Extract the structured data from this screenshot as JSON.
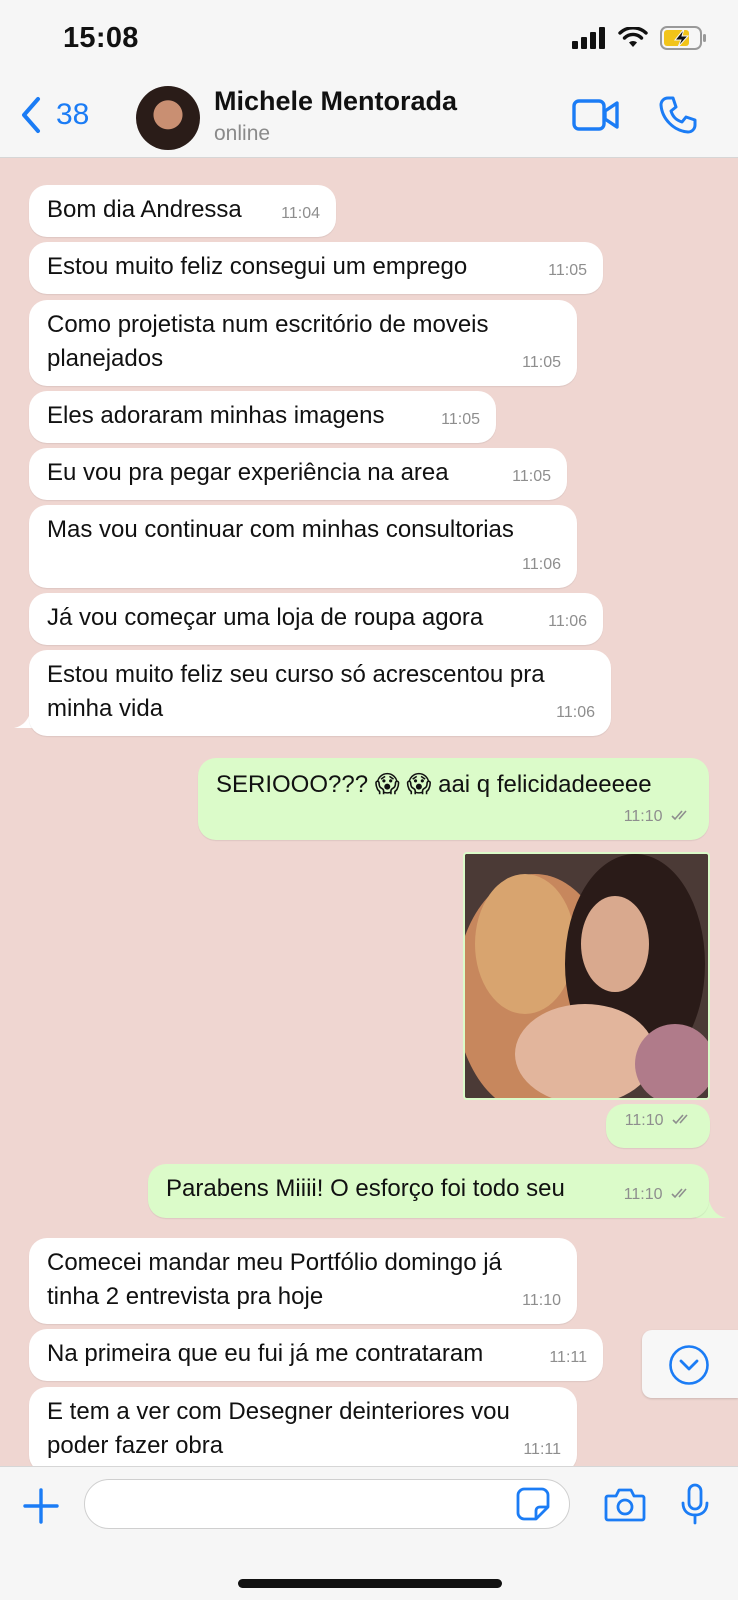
{
  "status_bar": {
    "time": "15:08"
  },
  "header": {
    "back_count": "38",
    "contact_name": "Michele Mentorada",
    "contact_status": "online"
  },
  "messages": [
    {
      "dir": "in",
      "text": "Bom dia Andressa",
      "time": "11:04"
    },
    {
      "dir": "in",
      "text": "Estou muito feliz consegui um emprego",
      "time": "11:05"
    },
    {
      "dir": "in",
      "text": "Como projetista num escritório de moveis\nplanejados",
      "time": "11:05"
    },
    {
      "dir": "in",
      "text": "Eles adoraram minhas imagens",
      "time": "11:05"
    },
    {
      "dir": "in",
      "text": "Eu vou pra pegar experiência na area",
      "time": "11:05"
    },
    {
      "dir": "in",
      "text": "Mas vou continuar com minhas consultorias",
      "time": "11:06"
    },
    {
      "dir": "in",
      "text": "Já vou começar uma loja de roupa agora",
      "time": "11:06"
    },
    {
      "dir": "in",
      "text": "Estou muito feliz seu curso só acrescentou pra\nminha vida",
      "time": "11:06"
    },
    {
      "dir": "out",
      "text": "SERIOOO??? 😱 😱 aai q felicidadeeeee",
      "time": "11:10"
    },
    {
      "dir": "out",
      "type": "image",
      "time": "11:10"
    },
    {
      "dir": "out",
      "text": "Parabens Miiii! O esforço foi todo seu",
      "time": "11:10"
    },
    {
      "dir": "in",
      "text": "Comecei mandar meu Portfólio domingo já\ntinha 2 entrevista pra hoje",
      "time": "11:10"
    },
    {
      "dir": "in",
      "text": "Na primeira que eu fui já me contrataram",
      "time": "11:11"
    },
    {
      "dir": "in",
      "text": "E tem a ver com Desegner deinteriores vou\npoder fazer obra",
      "time": "11:11"
    }
  ],
  "composer": {
    "placeholder": ""
  },
  "colors": {
    "accent": "#1b7cf5",
    "chat_bg": "#efd6d1",
    "incoming_bubble": "#ffffff",
    "outgoing_bubble": "#dbfbc9",
    "read_ticks": "#8e8e8e"
  },
  "icons": {
    "back": "chevron-left-icon",
    "video": "video-camera-icon",
    "call": "phone-icon",
    "plus": "plus-icon",
    "sticker": "sticker-icon",
    "camera": "camera-icon",
    "mic": "microphone-icon",
    "scroll": "chevron-down-circle-icon"
  }
}
